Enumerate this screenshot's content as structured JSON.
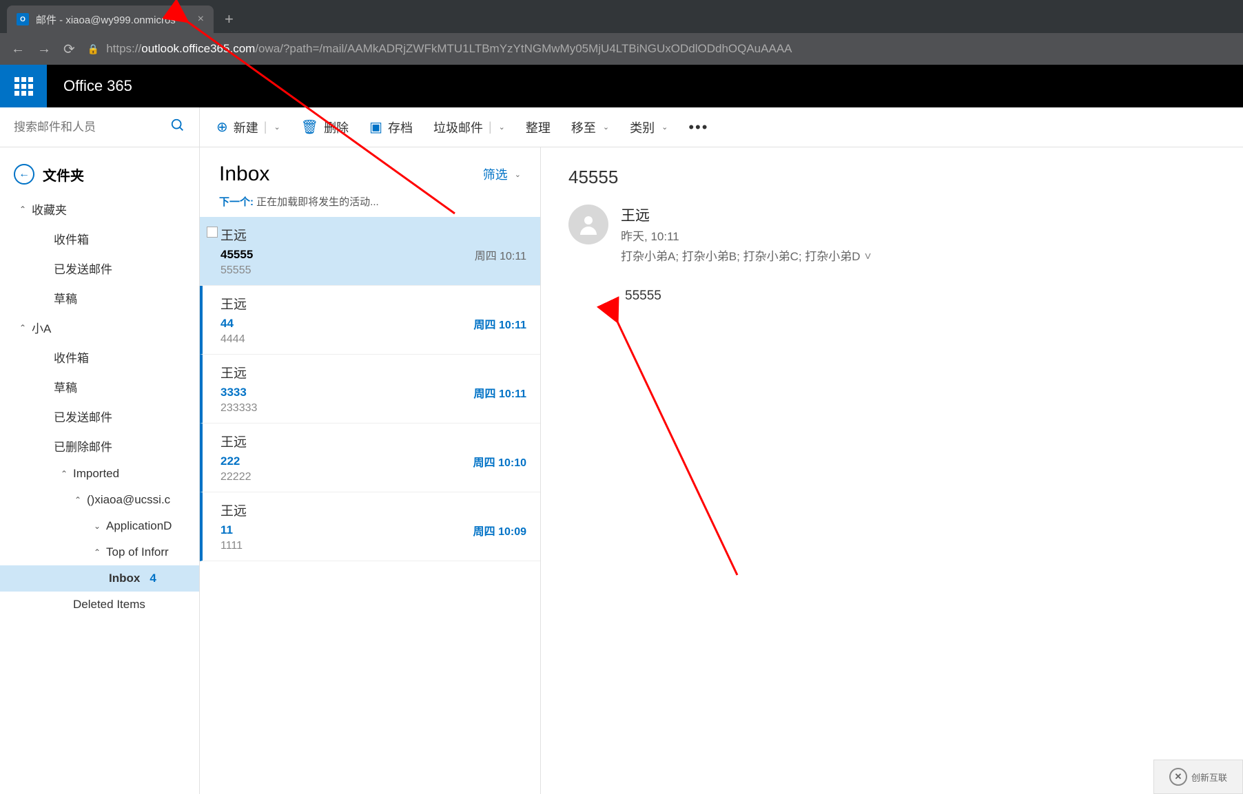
{
  "browser": {
    "tab_title": "邮件 - xiaoa@wy999.onmicros",
    "tab_icon": "O",
    "url_scheme": "https://",
    "url_host": "outlook.office365.com",
    "url_path": "/owa/?path=/mail/AAMkADRjZWFkMTU1LTBmYzYtNGMwMy05MjU4LTBiNGUxODdlODdhOQAuAAAA"
  },
  "header": {
    "brand": "Office 365"
  },
  "search": {
    "placeholder": "搜索邮件和人员"
  },
  "folders": {
    "title": "文件夹",
    "favorites": "收藏夹",
    "fav_items": [
      "收件箱",
      "已发送邮件",
      "草稿"
    ],
    "group_a": "小A",
    "a_items": [
      "收件箱",
      "草稿",
      "已发送邮件",
      "已删除邮件"
    ],
    "imported": "Imported",
    "imported_account": "()xiaoa@ucssi.c",
    "imported_sub1": "ApplicationD",
    "imported_sub2": "Top of Inforr",
    "inbox_label": "Inbox",
    "inbox_count": "4",
    "deleted_label": "Deleted Items"
  },
  "toolbar": {
    "new": "新建",
    "delete": "删除",
    "archive": "存档",
    "junk": "垃圾邮件",
    "sweep": "整理",
    "move": "移至",
    "category": "类别"
  },
  "list": {
    "title": "Inbox",
    "filter": "筛选",
    "next_label": "下一个:",
    "next_text": "正在加载即将发生的活动...",
    "items": [
      {
        "from": "王远",
        "subject": "45555",
        "time": "周四 10:11",
        "preview": "55555",
        "selected": true,
        "unread": false
      },
      {
        "from": "王远",
        "subject": "44",
        "time": "周四 10:11",
        "preview": "4444",
        "selected": false,
        "unread": true
      },
      {
        "from": "王远",
        "subject": "3333",
        "time": "周四 10:11",
        "preview": "233333",
        "selected": false,
        "unread": true
      },
      {
        "from": "王远",
        "subject": "222",
        "time": "周四 10:10",
        "preview": "22222",
        "selected": false,
        "unread": true
      },
      {
        "from": "王远",
        "subject": "11",
        "time": "周四 10:09",
        "preview": "1111",
        "selected": false,
        "unread": true
      }
    ]
  },
  "reading": {
    "subject": "45555",
    "sender": "王远",
    "time": "昨天, 10:11",
    "recipients": "打杂小弟A; 打杂小弟B; 打杂小弟C; 打杂小弟D",
    "body": "55555"
  },
  "watermark": {
    "text": "创新互联"
  }
}
